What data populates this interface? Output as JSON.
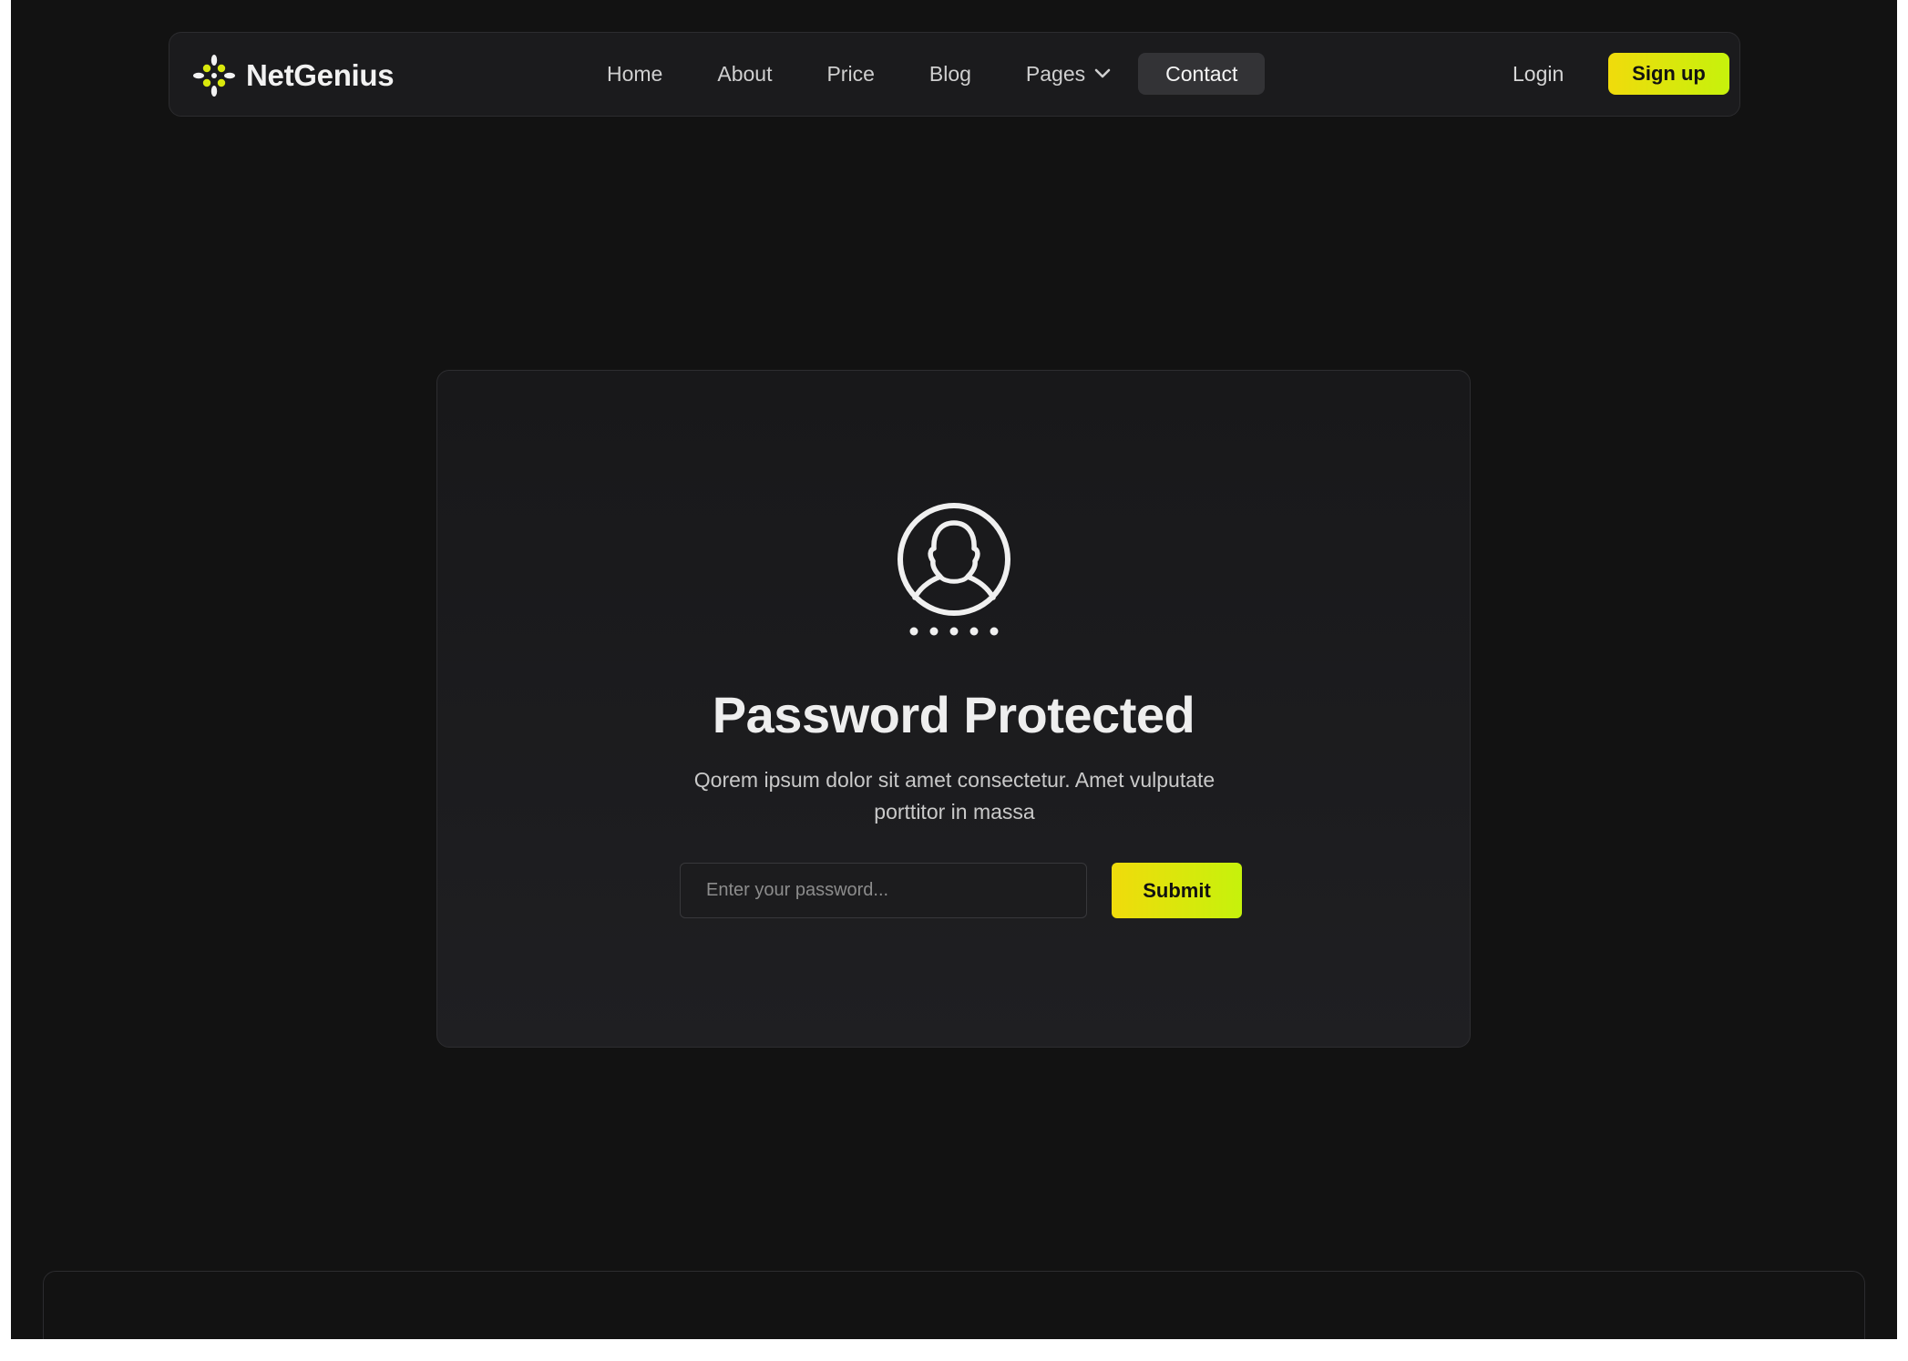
{
  "brand": {
    "name": "NetGenius",
    "accent_color": "#d9e80c",
    "logo_icon": "sparkle-dots-icon"
  },
  "nav": {
    "items": [
      {
        "label": "Home"
      },
      {
        "label": "About"
      },
      {
        "label": "Price"
      },
      {
        "label": "Blog"
      },
      {
        "label": "Pages",
        "has_dropdown": true
      },
      {
        "label": "Contact",
        "active": true
      }
    ],
    "login_label": "Login",
    "signup_label": "Sign up"
  },
  "card": {
    "icon": "user-lock-icon",
    "title": "Password Protected",
    "description": "Qorem ipsum dolor sit amet consectetur. Amet vulputate porttitor in massa",
    "password_placeholder": "Enter your password...",
    "password_value": "",
    "submit_label": "Submit"
  }
}
